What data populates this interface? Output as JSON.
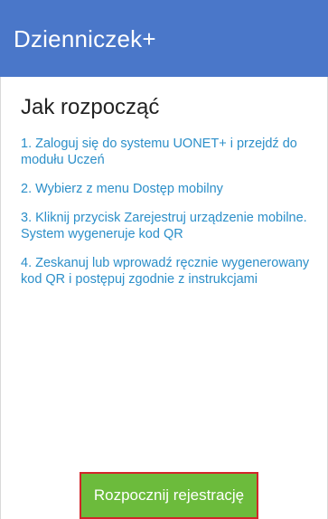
{
  "colors": {
    "app_bar": "#4a77c9",
    "link_text": "#2c8fc9",
    "button_bg": "#6cbb3c",
    "button_border": "#d2252a"
  },
  "app_bar": {
    "title": "Dzienniczek+"
  },
  "main": {
    "heading": "Jak rozpocząć",
    "steps": [
      "1. Zaloguj się do systemu UONET+ i przejdź do modułu Uczeń",
      "2. Wybierz z menu Dostęp mobilny",
      "3. Kliknij przycisk Zarejestruj urządzenie mobilne. System wygeneruje kod QR",
      "4. Zeskanuj lub wprowadź ręcznie wygenerowany kod QR i postępuj zgodnie z instrukcjami"
    ]
  },
  "footer": {
    "start_button_label": "Rozpocznij rejestrację"
  }
}
